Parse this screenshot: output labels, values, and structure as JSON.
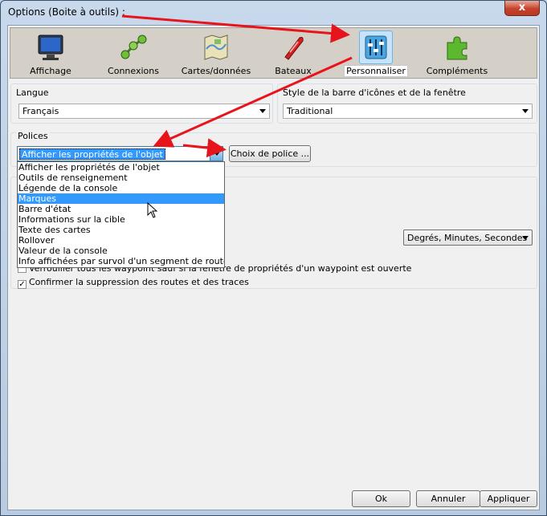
{
  "window": {
    "title": "Options (Boite à outils) :",
    "close_glyph": "x"
  },
  "toolbar": {
    "items": [
      {
        "label": "Affichage",
        "icon": "monitor-icon",
        "selected": false
      },
      {
        "label": "Connexions",
        "icon": "network-nodes-icon",
        "selected": false
      },
      {
        "label": "Cartes/données",
        "icon": "chart-map-icon",
        "selected": false
      },
      {
        "label": "Bateaux",
        "icon": "boat-icon",
        "selected": false
      },
      {
        "label": "Personnaliser",
        "icon": "sliders-icon",
        "selected": true
      },
      {
        "label": "Compléments",
        "icon": "puzzle-icon",
        "selected": false
      }
    ]
  },
  "langue": {
    "title": "Langue",
    "value": "Français"
  },
  "style": {
    "title": "Style de la barre d'icônes et de la fenêtre",
    "value": "Traditional"
  },
  "polices": {
    "title": "Polices",
    "selected": "Afficher les propriétés de l'objet",
    "button": "Choix de police ...",
    "options": [
      "Afficher les propriétés de l'objet",
      "Outils de renseignement",
      "Légende de la console",
      "Marques",
      "Barre d'état",
      "Informations sur la cible",
      "Texte des cartes",
      "Rollover",
      "Valeur de la console",
      "Info affichées par survol d'un segment de route"
    ],
    "highlighted_index": 3
  },
  "coords": {
    "value": "Degrés, Minutes, Secondes"
  },
  "checks": {
    "waypoint_lock": {
      "label": "Verrouiller tous les waypoint sauf si la fenêtre de propriétés d'un waypoint est ouverte",
      "checked": false
    },
    "confirm_delete": {
      "label": "Confirmer la suppression des routes et des traces",
      "checked": true
    }
  },
  "buttons": {
    "ok": "Ok",
    "cancel": "Annuler",
    "apply": "Appliquer"
  },
  "colors": {
    "annotation_arrow": "#e8141c",
    "selection": "#3399ff"
  }
}
